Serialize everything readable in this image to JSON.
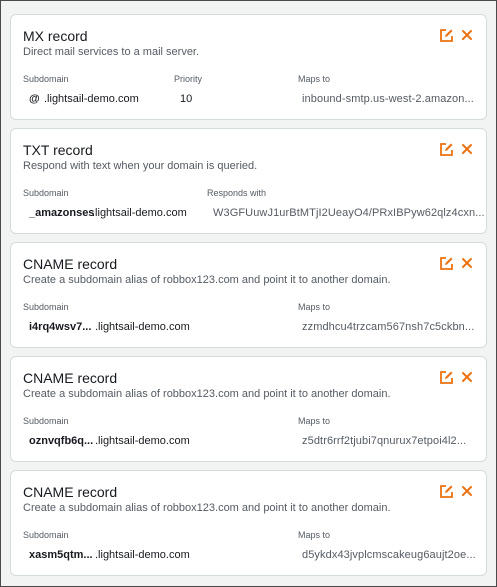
{
  "accent_color": "#ec7211",
  "icons": {
    "edit": "edit-icon",
    "delete": "close-icon"
  },
  "records": [
    {
      "title": "MX record",
      "description": "Direct mail services to a mail server.",
      "col1_label": "Subdomain",
      "subdomain": "@",
      "domain_suffix": ".lightsail-demo.com",
      "col2_label": "Priority",
      "priority": "10",
      "col3_label": "Maps to",
      "target": "inbound-smtp.us-west-2.amazon..."
    },
    {
      "title": "TXT record",
      "description": "Respond with text when your domain is queried.",
      "col1_label": "Subdomain",
      "subdomain": "_amazonses",
      "domain_suffix": ".lightsail-demo.com",
      "col3_label": "Responds with",
      "target": "W3GFUuwJ1urBtMTjI2UeayO4/PRxIBPyw62qlz4cxn..."
    },
    {
      "title": "CNAME record",
      "description": "Create a subdomain alias of robbox123.com and point it to another domain.",
      "col1_label": "Subdomain",
      "subdomain": "i4rq4wsv7...",
      "domain_suffix": ".lightsail-demo.com",
      "col3_label": "Maps to",
      "target": "zzmdhcu4trzcam567nsh7c5ckbn..."
    },
    {
      "title": "CNAME record",
      "description": "Create a subdomain alias of robbox123.com and point it to another domain.",
      "col1_label": "Subdomain",
      "subdomain": "oznvqfb6q...",
      "domain_suffix": ".lightsail-demo.com",
      "col3_label": "Maps to",
      "target": "z5dtr6rrf2tjubi7qnurux7etpoi4l2..."
    },
    {
      "title": "CNAME record",
      "description": "Create a subdomain alias of robbox123.com and point it to another domain.",
      "col1_label": "Subdomain",
      "subdomain": "xasm5qtm...",
      "domain_suffix": ".lightsail-demo.com",
      "col3_label": "Maps to",
      "target": "d5ykdx43jvplcmscakeug6aujt2oe..."
    }
  ]
}
